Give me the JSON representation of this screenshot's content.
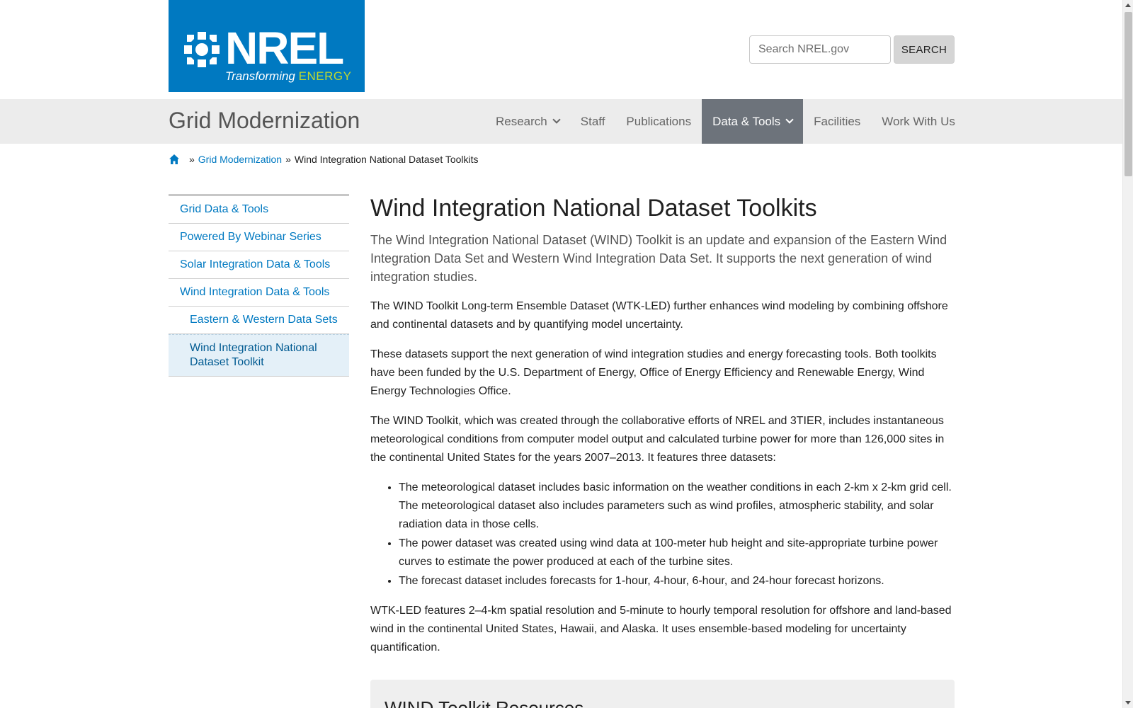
{
  "header": {
    "logo": {
      "name": "NREL",
      "tagline_prefix": "Transforming",
      "tagline_emphasis": "ENERGY",
      "brand_color": "#0079c1",
      "accent_color": "#c1d82f"
    },
    "search": {
      "placeholder": "Search NREL.gov",
      "value": "",
      "button_label": "SEARCH"
    }
  },
  "section": {
    "title": "Grid Modernization",
    "nav": [
      {
        "label": "Research",
        "has_dropdown": true,
        "active": false
      },
      {
        "label": "Staff",
        "has_dropdown": false,
        "active": false
      },
      {
        "label": "Publications",
        "has_dropdown": false,
        "active": false
      },
      {
        "label": "Data & Tools",
        "has_dropdown": true,
        "active": true
      },
      {
        "label": "Facilities",
        "has_dropdown": false,
        "active": false
      },
      {
        "label": "Work With Us",
        "has_dropdown": false,
        "active": false
      }
    ]
  },
  "breadcrumb": {
    "home_icon": "home-icon",
    "separator": "»",
    "items": [
      {
        "label": "Grid Modernization",
        "link": true
      },
      {
        "label": "Wind Integration National Dataset Toolkits",
        "link": false
      }
    ]
  },
  "sidebar": {
    "items": [
      {
        "label": "Grid Data & Tools",
        "level": 1,
        "current": false
      },
      {
        "label": "Powered By Webinar Series",
        "level": 1,
        "current": false
      },
      {
        "label": "Solar Integration Data & Tools",
        "level": 1,
        "current": false
      },
      {
        "label": "Wind Integration Data & Tools",
        "level": 1,
        "current": false
      },
      {
        "label": "Eastern & Western Data Sets",
        "level": 2,
        "current": false
      },
      {
        "label": "Wind Integration National Dataset Toolkit",
        "level": 2,
        "current": true
      }
    ]
  },
  "main": {
    "title": "Wind Integration National Dataset Toolkits",
    "lead": "The Wind Integration National Dataset (WIND) Toolkit is an update and expansion of the Eastern Wind Integration Data Set and Western Wind Integration Data Set. It supports the next generation of wind integration studies.",
    "p1": "The WIND Toolkit Long-term Ensemble Dataset (WTK-LED) further enhances wind modeling by combining offshore and continental datasets and by quantifying model uncertainty.",
    "p2": "These datasets support the next generation of wind integration studies and energy forecasting tools. Both toolkits have been funded by the U.S. Department of Energy, Office of Energy Efficiency and Renewable Energy, Wind Energy Technologies Office.",
    "p3": "The WIND Toolkit, which was created through the collaborative efforts of NREL and 3TIER, includes instantaneous meteorological conditions from computer model output and calculated turbine power for more than 126,000 sites in the continental United States for the years 2007–2013. It features three datasets:",
    "bullets": [
      "The meteorological dataset includes basic information on the weather conditions in each 2-km x 2-km grid cell. The meteorological dataset also includes parameters such as wind profiles, atmospheric stability, and solar radiation data in those cells.",
      "The power dataset was created using wind data at 100-meter hub height and site-appropriate turbine power curves to estimate the power produced at each of the turbine sites.",
      "The forecast dataset includes forecasts for 1-hour, 4-hour, 6-hour, and 24-hour forecast horizons."
    ],
    "p4": "WTK-LED features 2–4-km spatial resolution and 5-minute to hourly temporal resolution for offshore and land-based wind in the continental United States, Hawaii, and Alaska. It uses ensemble-based modeling for uncertainty quantification.",
    "resources_heading": "WIND Toolkit Resources"
  }
}
